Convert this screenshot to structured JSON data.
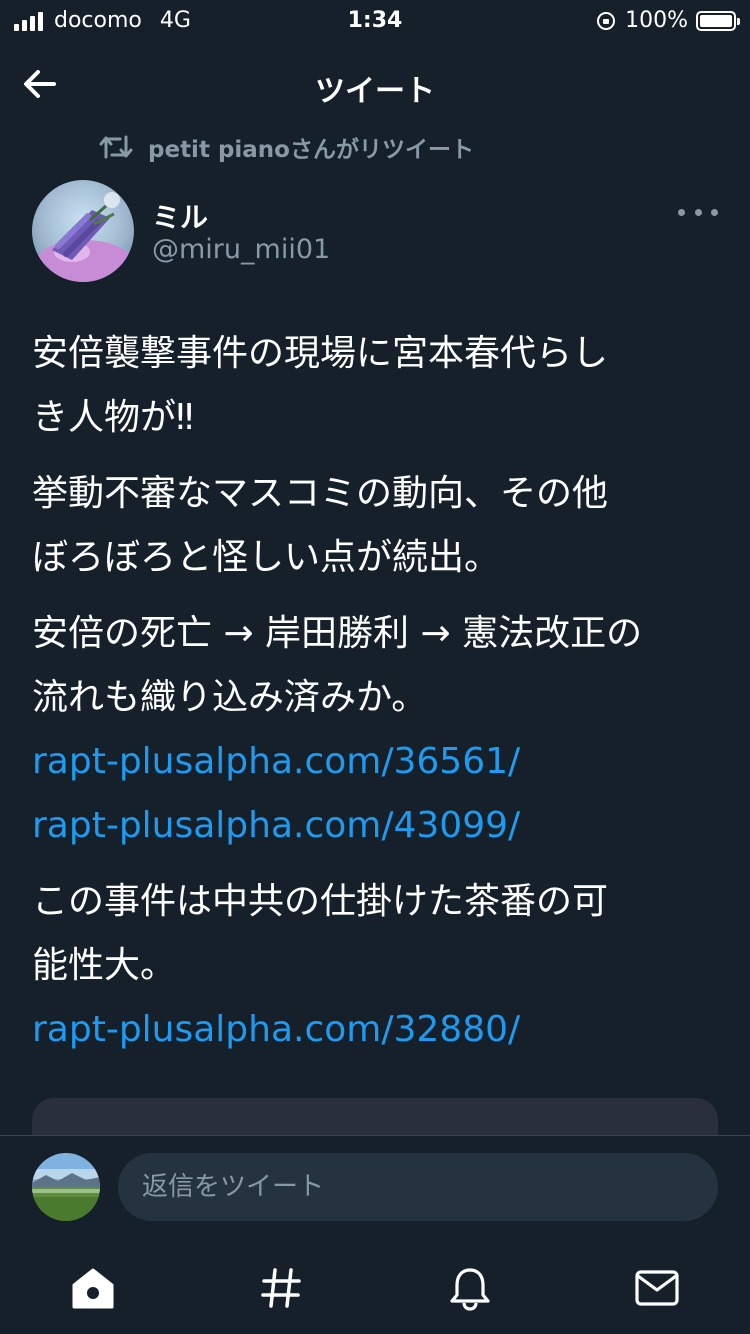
{
  "status_bar": {
    "carrier": "docomo",
    "network": "4G",
    "time": "1:34",
    "battery": "100%"
  },
  "header": {
    "title": "ツイート",
    "back_icon": "arrow-left-icon"
  },
  "retweet": {
    "icon": "retweet-icon",
    "text": "petit pianoさんがリツイート"
  },
  "author": {
    "name": "ミル",
    "handle": "@miru_mii01",
    "more_icon": "more-horizontal-icon"
  },
  "tweet": {
    "line1": "安倍襲撃事件の現場に宮本春代らし",
    "line2": "き人物が‼︎",
    "line3": "挙動不審なマスコミの動向、その他",
    "line4": "ぼろぼろと怪しい点が続出。",
    "line5": "安倍の死亡 → 岸田勝利 → 憲法改正の",
    "line6": "流れも織り込み済みか。",
    "link1": "rapt-plusalpha.com/36561/",
    "link2": "rapt-plusalpha.com/43099/",
    "line7": "この事件は中共の仕掛けた茶番の可",
    "line8": "能性大。",
    "link3": "rapt-plusalpha.com/32880/"
  },
  "reply": {
    "placeholder": "返信をツイート"
  },
  "nav": {
    "home_icon": "home-icon",
    "explore_icon": "hashtag-icon",
    "notifications_icon": "bell-icon",
    "messages_icon": "mail-icon"
  },
  "colors": {
    "background": "#15202b",
    "link": "#1d9bf0",
    "secondary_text": "#8899a6",
    "input_bg": "#253341"
  }
}
